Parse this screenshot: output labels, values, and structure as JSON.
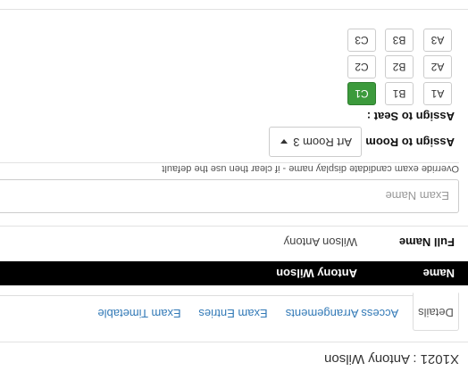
{
  "page": {
    "title": "X1021 : Antony Wilson"
  },
  "tabs": [
    {
      "label": "Details",
      "active": true
    },
    {
      "label": "Access Arrangements",
      "active": false
    },
    {
      "label": "Exam Entries",
      "active": false
    },
    {
      "label": "Exam Timetable",
      "active": false
    }
  ],
  "name_row": {
    "label": "Name",
    "value": "Antony Wilson"
  },
  "full_name_row": {
    "label": "Full Name",
    "value": "Wilson Antony"
  },
  "exam_name": {
    "placeholder": "Exam Name",
    "value": ""
  },
  "override_hint": "Override exam candidate display name - if clear then use the default",
  "assign_room": {
    "label": "Assign to Room :",
    "selected": "Art Room 3",
    "caret_icon": "caret-down-icon"
  },
  "assign_seat": {
    "label": "Assign to Seat :"
  },
  "seats": {
    "row1": [
      "C1",
      "B1",
      "A1"
    ],
    "row2": [
      "C2",
      "B2",
      "A2"
    ],
    "row3": [
      "C3",
      "B3",
      "A3"
    ],
    "selected": "C1",
    "selected_color": "#3c9a3c"
  }
}
